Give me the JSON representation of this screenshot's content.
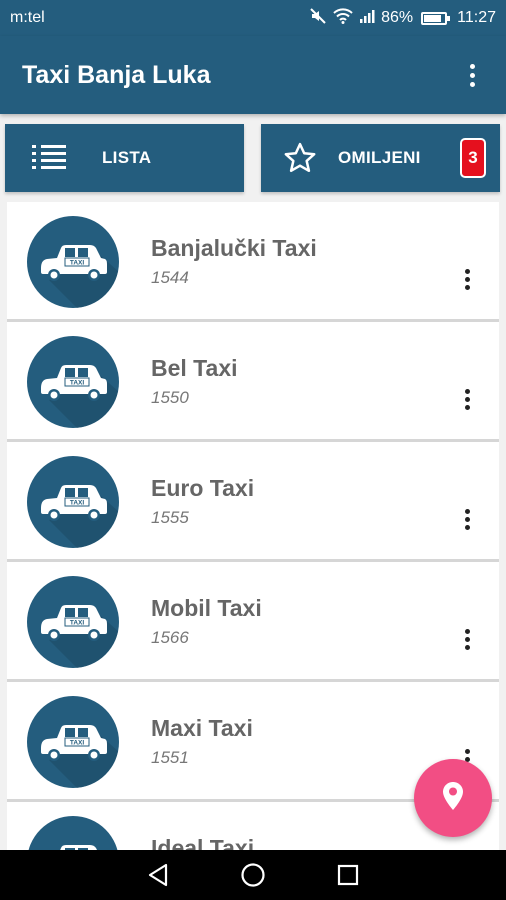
{
  "status_bar": {
    "carrier": "m:tel",
    "battery_percent": "86%",
    "battery_level": 0.86,
    "time": "11:27",
    "icons": [
      "mute-icon",
      "wifi-icon",
      "signal-icon",
      "battery-icon"
    ]
  },
  "app_bar": {
    "title": "Taxi Banja Luka",
    "menu_icon": "more-vert-icon"
  },
  "tabs": {
    "lista": {
      "label": "LISTA",
      "icon": "list-icon"
    },
    "omiljeni": {
      "label": "OMILJENI",
      "icon": "star-icon",
      "badge": "3"
    }
  },
  "taxis": [
    {
      "name": "Banjalučki Taxi",
      "phone": "1544"
    },
    {
      "name": "Bel Taxi",
      "phone": "1550"
    },
    {
      "name": "Euro Taxi",
      "phone": "1555"
    },
    {
      "name": "Mobil Taxi",
      "phone": "1566"
    },
    {
      "name": "Maxi Taxi",
      "phone": "1551"
    },
    {
      "name": "Ideal Taxi",
      "phone": ""
    }
  ],
  "avatar_text": "TAXI",
  "fab": {
    "icon": "location-pin-icon"
  },
  "colors": {
    "primary": "#245d7e",
    "accent": "#f24e84",
    "badge": "#e5101e",
    "background": "#f1f1f1"
  }
}
